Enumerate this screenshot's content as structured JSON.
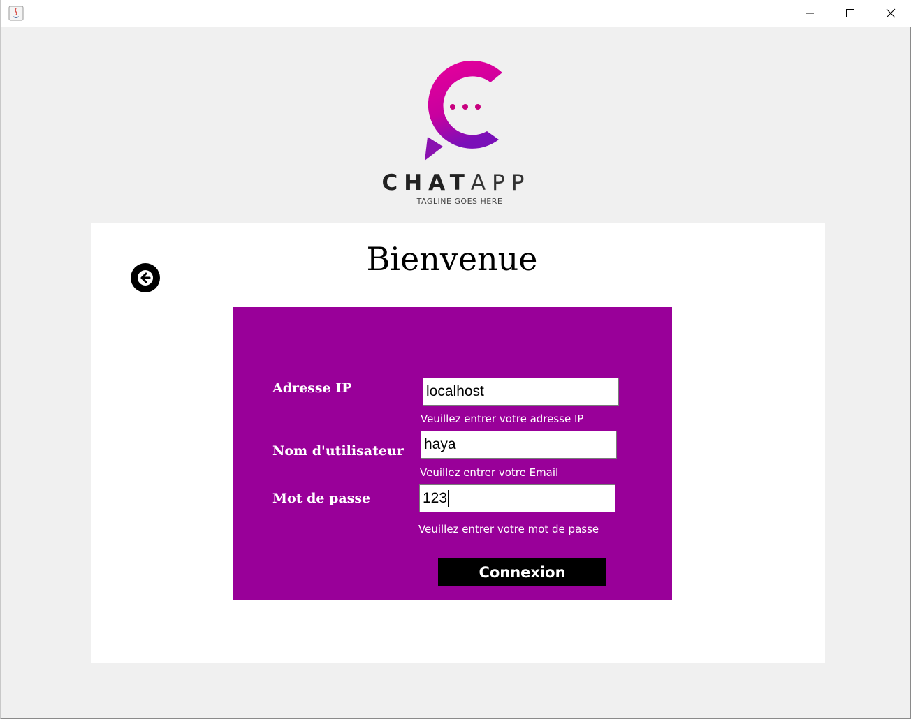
{
  "window": {
    "icons": {
      "app": "java-icon",
      "minimize": "minimize-icon",
      "maximize": "maximize-icon",
      "close": "close-icon"
    }
  },
  "logo": {
    "word_bold": "CHAT",
    "word_thin": "APP",
    "tagline": "TAGLINE GOES HERE",
    "colors": {
      "gradient_start": "#e8009a",
      "gradient_end": "#7a10b8"
    }
  },
  "card": {
    "title": "Bienvenue",
    "back_icon": "arrow-left-icon"
  },
  "form": {
    "background": "#990099",
    "fields": [
      {
        "label": "Adresse IP",
        "value": "localhost",
        "hint": "Veuillez entrer votre adresse IP"
      },
      {
        "label": "Nom d'utilisateur",
        "value": "haya",
        "hint": "Veuillez entrer votre Email"
      },
      {
        "label": "Mot de passe",
        "value": "123",
        "hint": "Veuillez entrer votre mot de passe"
      }
    ],
    "submit_label": "Connexion"
  }
}
